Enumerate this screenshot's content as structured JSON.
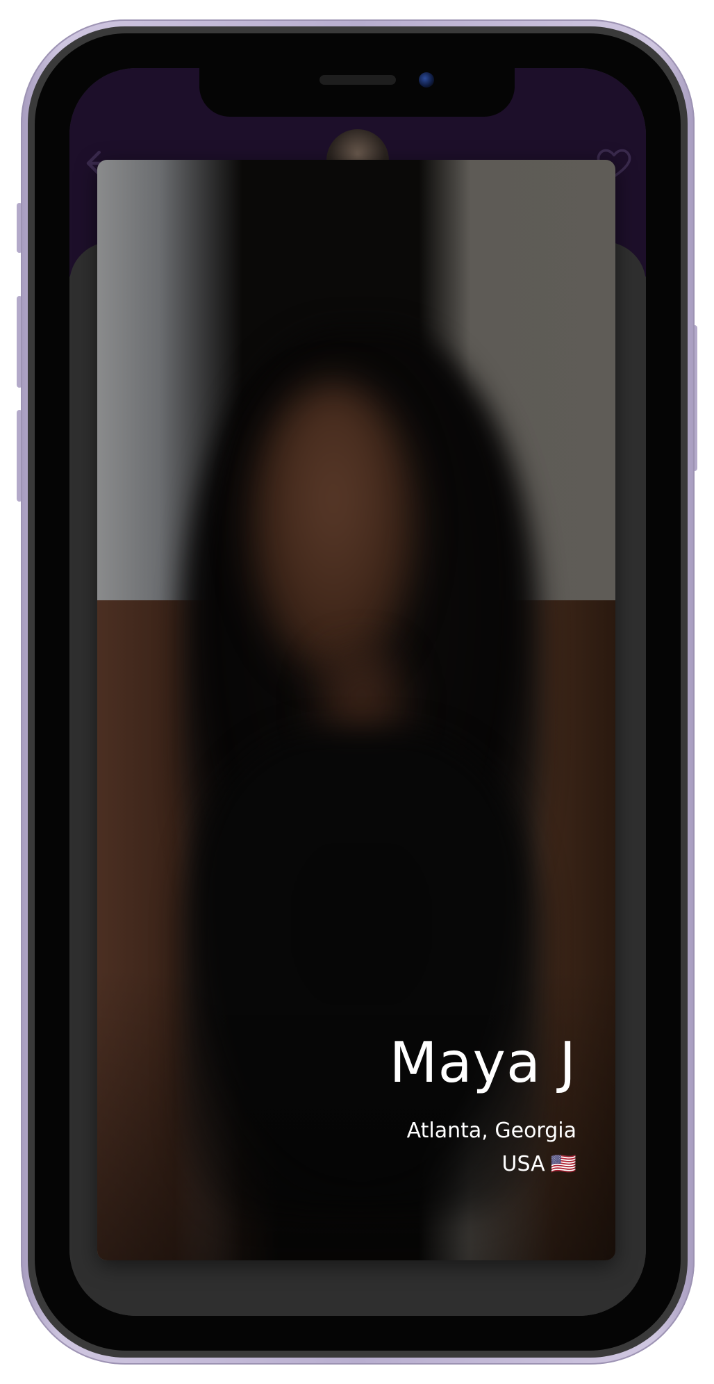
{
  "profile": {
    "name": "Maya J",
    "city": "Atlanta, Georgia",
    "country": "USA",
    "flag": "🇺🇸"
  },
  "header": {
    "back_icon": "arrow-left-icon",
    "like_icon": "heart-outline-icon"
  },
  "colors": {
    "header_bg": "#1d0f2a",
    "sheet_bg": "#2f2f2f",
    "device_frame": "#b8aecf"
  }
}
